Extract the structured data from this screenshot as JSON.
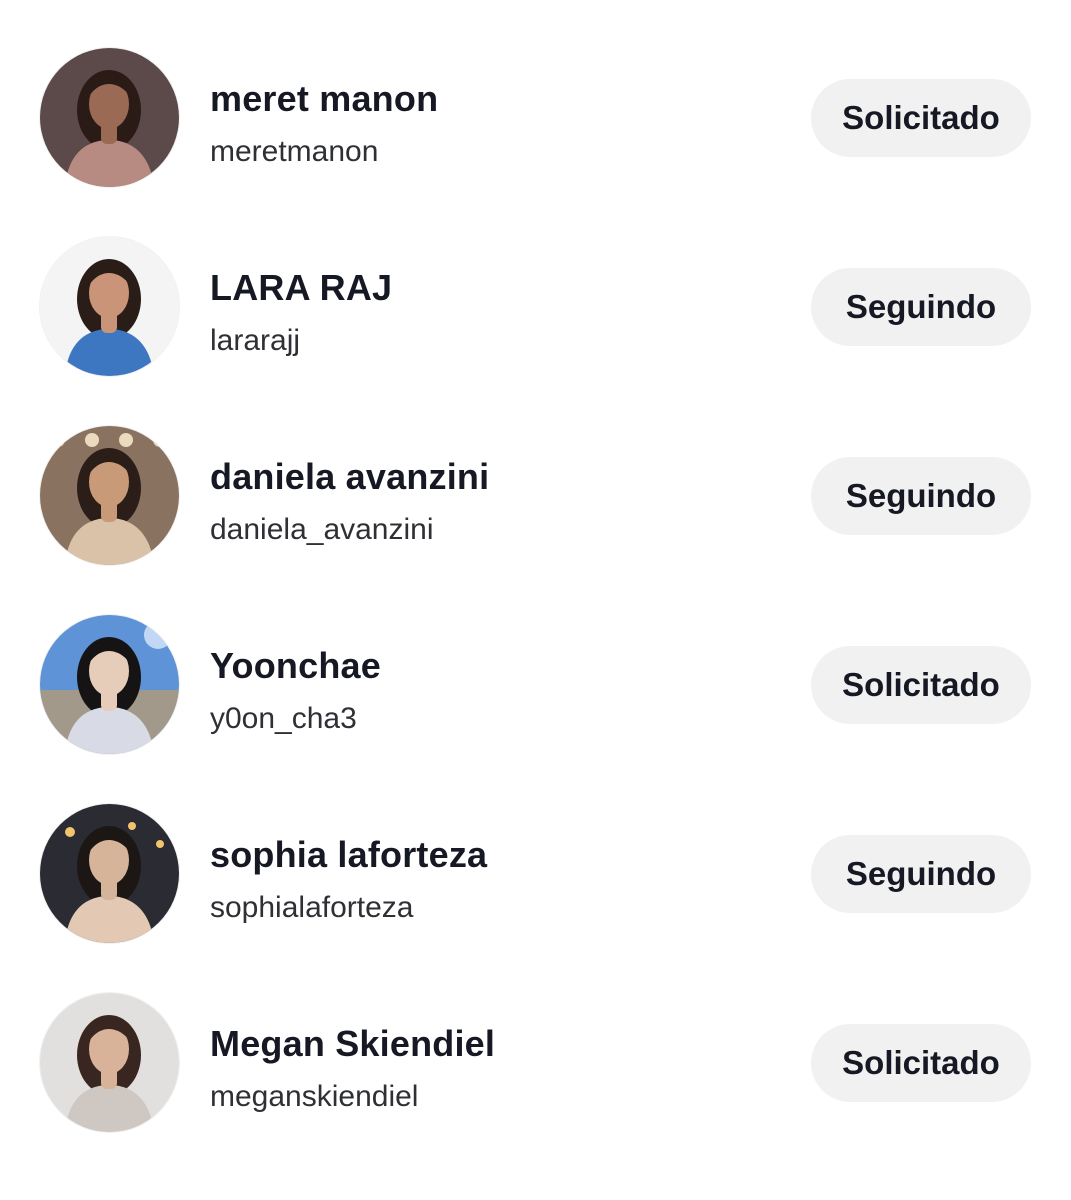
{
  "accounts": [
    {
      "display_name": "meret manon",
      "username": "meretmanon",
      "status_label": "Solicitado",
      "avatar_palette": {
        "bg": "#5b4a49",
        "skin": "#9a6a55",
        "hair": "#2a1b17",
        "cloth": "#b78b82",
        "accent": "#8fb8b2"
      }
    },
    {
      "display_name": "LARA RAJ",
      "username": "lararajj",
      "status_label": "Seguindo",
      "avatar_palette": {
        "bg": "#f4f4f5",
        "skin": "#c99478",
        "hair": "#2a1d17",
        "cloth": "#3d77c2",
        "accent": "#e8e8ea"
      }
    },
    {
      "display_name": "daniela avanzini",
      "username": "daniela_avanzini",
      "status_label": "Seguindo",
      "avatar_palette": {
        "bg": "#8a7260",
        "skin": "#c89a78",
        "hair": "#2b1e18",
        "cloth": "#d9c2a8",
        "accent": "#f5e6c8"
      }
    },
    {
      "display_name": "Yoonchae",
      "username": "y0on_cha3",
      "status_label": "Solicitado",
      "avatar_palette": {
        "bg": "#5f93d8",
        "skin": "#e6cdb9",
        "hair": "#161314",
        "cloth": "#d8dbe6",
        "accent": "#a3998a"
      }
    },
    {
      "display_name": "sophia laforteza",
      "username": "sophialaforteza",
      "status_label": "Seguindo",
      "avatar_palette": {
        "bg": "#2a2b33",
        "skin": "#d6b49a",
        "hair": "#1c1615",
        "cloth": "#e3c9b4",
        "accent": "#f2c46b"
      }
    },
    {
      "display_name": "Megan Skiendiel",
      "username": "meganskiendiel",
      "status_label": "Solicitado",
      "avatar_palette": {
        "bg": "#e2e0de",
        "skin": "#d9b29a",
        "hair": "#3a2620",
        "cloth": "#cfc8c2",
        "accent": "#ecebea"
      }
    }
  ]
}
